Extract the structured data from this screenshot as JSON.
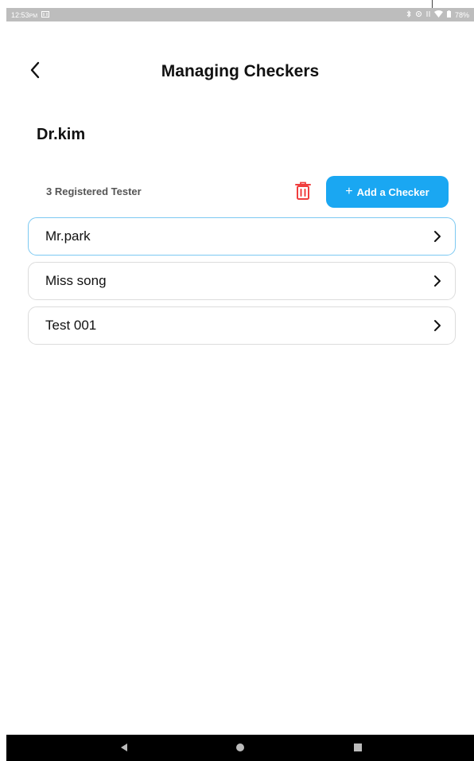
{
  "status_bar": {
    "time": "12:53",
    "ampm": "PM",
    "battery": "78%"
  },
  "header": {
    "title": "Managing Checkers"
  },
  "owner_name": "Dr.kim",
  "toolbar": {
    "count_label": "3 Registered Tester",
    "add_button_plus": "+",
    "add_button_label": "Add a Checker"
  },
  "checkers": [
    {
      "name": "Mr.park",
      "selected": true
    },
    {
      "name": "Miss song",
      "selected": false
    },
    {
      "name": "Test 001",
      "selected": false
    }
  ],
  "colors": {
    "accent": "#1aa7f2",
    "delete_icon": "#f03e3e",
    "selected_border": "#7cc9f2",
    "row_border": "#dcdcdc"
  },
  "icons": {
    "back": "chevron-left-icon",
    "delete": "trash-icon",
    "row_arrow": "chevron-right-icon"
  }
}
